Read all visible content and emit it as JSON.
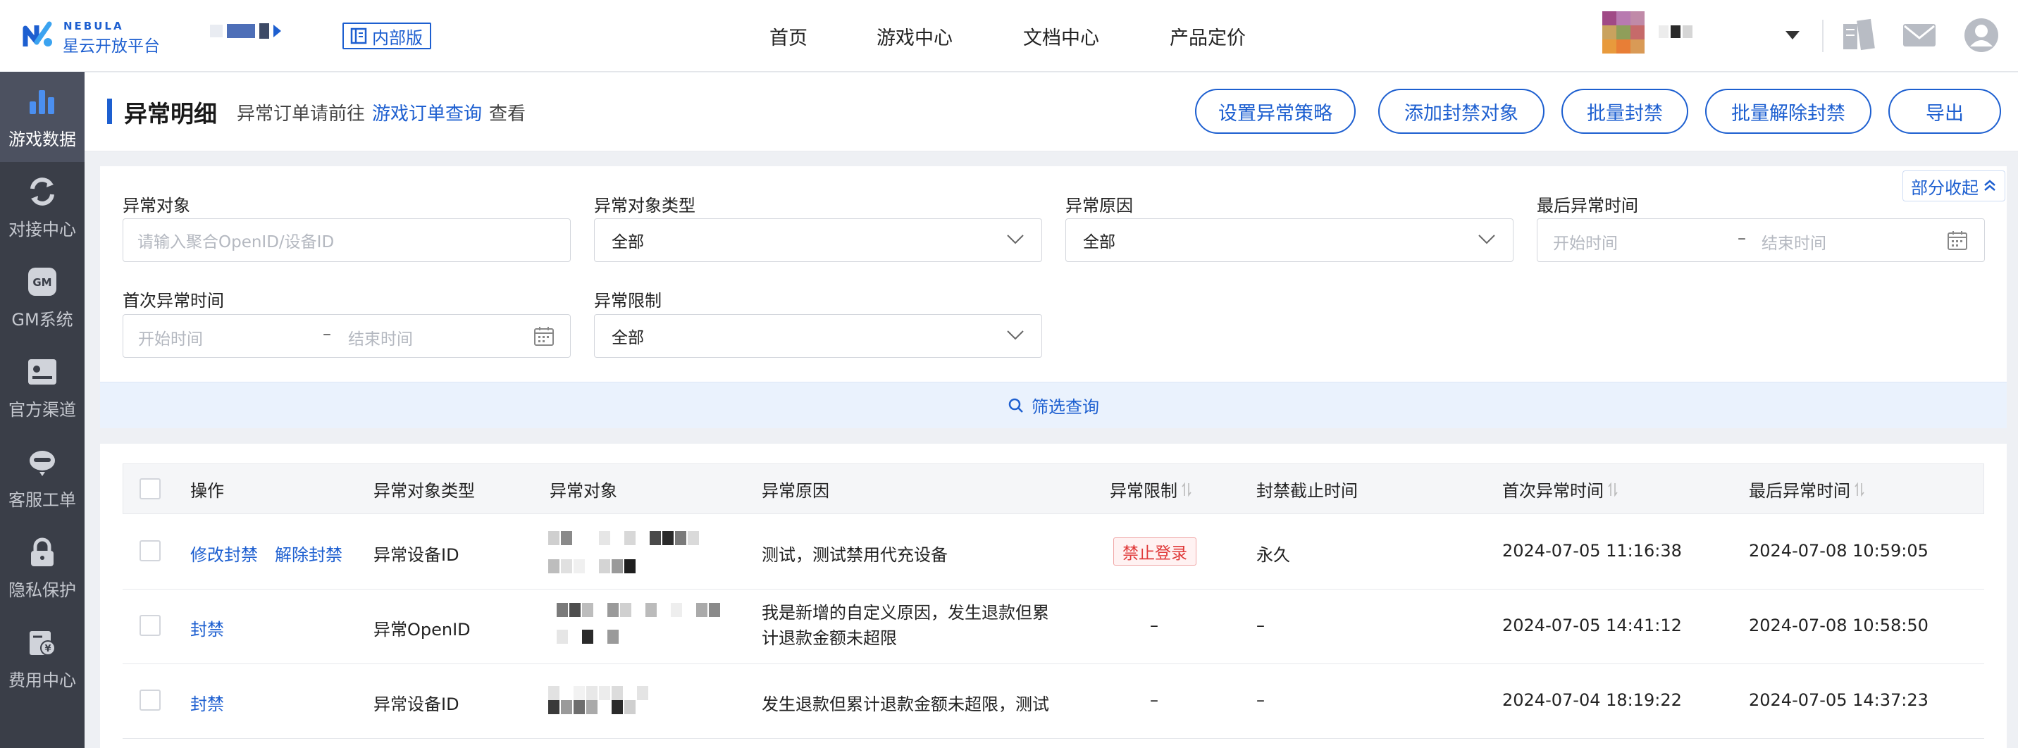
{
  "brand": {
    "name_en": "NEBULA",
    "name_cn": "星云开放平台",
    "internal_badge": "内部版"
  },
  "nav": {
    "items": [
      "首页",
      "游戏中心",
      "文档中心",
      "产品定价"
    ]
  },
  "sidebar": {
    "items": [
      {
        "label": "游戏数据",
        "icon": "bar-chart-icon",
        "active": true
      },
      {
        "label": "对接中心",
        "icon": "sync-icon",
        "active": false
      },
      {
        "label": "GM系统",
        "icon": "gm-icon",
        "active": false
      },
      {
        "label": "官方渠道",
        "icon": "id-card-icon",
        "active": false
      },
      {
        "label": "客服工单",
        "icon": "headset-icon",
        "active": false
      },
      {
        "label": "隐私保护",
        "icon": "lock-icon",
        "active": false
      },
      {
        "label": "费用中心",
        "icon": "wallet-icon",
        "active": false
      }
    ]
  },
  "header": {
    "title": "异常明细",
    "hint_prefix": "异常订单请前往",
    "hint_link": "游戏订单查询",
    "hint_suffix": "查看",
    "actions": [
      "设置异常策略",
      "添加封禁对象",
      "批量封禁",
      "批量解除封禁",
      "导出"
    ]
  },
  "filters": {
    "collapse_label": "部分收起",
    "object_label": "异常对象",
    "object_placeholder": "请输入聚合OpenID/设备ID",
    "object_type_label": "异常对象类型",
    "object_type_value": "全部",
    "reason_label": "异常原因",
    "reason_value": "全部",
    "last_time_label": "最后异常时间",
    "first_time_label": "首次异常时间",
    "limit_label": "异常限制",
    "limit_value": "全部",
    "start_placeholder": "开始时间",
    "end_placeholder": "结束时间",
    "range_sep": "–",
    "search_label": "筛选查询"
  },
  "table": {
    "columns": [
      "操作",
      "异常对象类型",
      "异常对象",
      "异常原因",
      "异常限制",
      "封禁截止时间",
      "首次异常时间",
      "最后异常时间"
    ],
    "rows": [
      {
        "actions": [
          "修改封禁",
          "解除封禁"
        ],
        "object_type": "异常设备ID",
        "reason": "测试，测试禁用代充设备",
        "limit": "禁止登录",
        "ban_until": "永久",
        "first_time": "2024-07-05 11:16:38",
        "last_time": "2024-07-08 10:59:05"
      },
      {
        "actions": [
          "封禁"
        ],
        "object_type": "异常OpenID",
        "reason": "我是新增的自定义原因，发生退款但累计退款金额未超限",
        "limit": "–",
        "ban_until": "–",
        "first_time": "2024-07-05 14:41:12",
        "last_time": "2024-07-08 10:58:50"
      },
      {
        "actions": [
          "封禁"
        ],
        "object_type": "异常设备ID",
        "reason": "发生退款但累计退款金额未超限，测试",
        "limit": "–",
        "ban_until": "–",
        "first_time": "2024-07-04 18:19:22",
        "last_time": "2024-07-05 14:37:23"
      }
    ]
  },
  "colors": {
    "accent": "#1d5fd0",
    "sidebar_bg": "#3a3e48",
    "danger": "#e03a3a"
  }
}
